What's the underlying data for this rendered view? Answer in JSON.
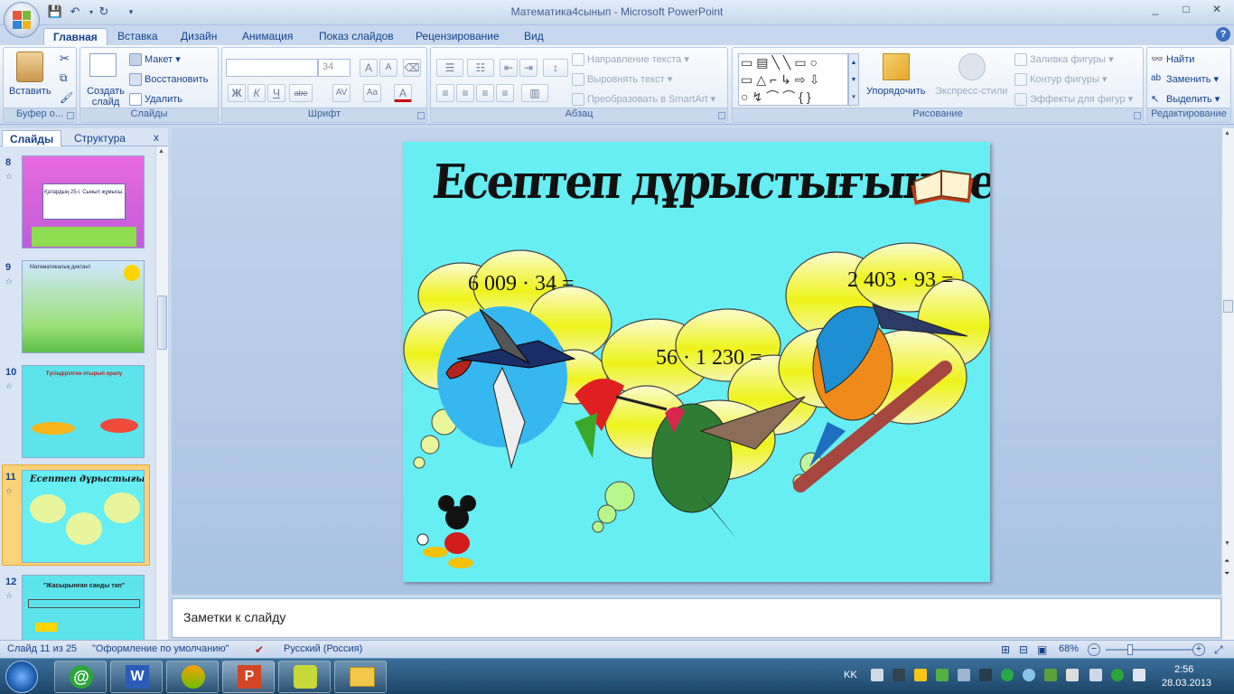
{
  "window": {
    "title": "Математика4сынып - Microsoft PowerPoint",
    "minimize": "_",
    "maximize": "□",
    "close": "✕"
  },
  "ribbon_tabs": [
    "Главная",
    "Вставка",
    "Дизайн",
    "Анимация",
    "Показ слайдов",
    "Рецензирование",
    "Вид"
  ],
  "help": "?",
  "groups": {
    "clipboard": {
      "label": "Буфер о...",
      "paste": "Вставить"
    },
    "slides": {
      "label": "Слайды",
      "new_slide": "Создать слайд",
      "layout": "Макет",
      "reset": "Восстановить",
      "delete": "Удалить"
    },
    "font": {
      "label": "Шрифт",
      "font_name": "",
      "font_size": "34",
      "bold": "Ж",
      "italic": "К",
      "underline": "Ч",
      "strike": "abe",
      "spacing": "AV",
      "case": "Aa",
      "color": "A",
      "grow": "A",
      "shrink": "A"
    },
    "paragraph": {
      "label": "Абзац",
      "text_direction": "Направление текста",
      "align_text": "Выровнять текст",
      "smartart": "Преобразовать в SmartArt"
    },
    "drawing": {
      "label": "Рисование",
      "arrange": "Упорядочить",
      "quick_styles": "Экспресс-стили",
      "shape_fill": "Заливка фигуры",
      "shape_outline": "Контур фигуры",
      "shape_effects": "Эффекты для фигур"
    },
    "editing": {
      "label": "Редактирование",
      "find": "Найти",
      "replace": "Заменить",
      "select": "Выделить"
    }
  },
  "left_pane": {
    "tab_slides": "Слайды",
    "tab_outline": "Структура",
    "close": "x",
    "thumbnails": [
      {
        "num": "8",
        "text": "Қатардың 25-і. Сынып жұмысы."
      },
      {
        "num": "9",
        "text": "Математикалық диктант"
      },
      {
        "num": "10",
        "text": "Түсіндірілген отырып оралу"
      },
      {
        "num": "11",
        "text": "Есептеп дұрыстығын тексер"
      },
      {
        "num": "12",
        "text": "\"Жасырынған санды тап\""
      }
    ]
  },
  "slide": {
    "title": "Есептеп дұрыстығын тексер",
    "expr1": "6 009 · 34 =",
    "expr2": "56 · 1 230 =",
    "expr3": "2 403 · 93 ="
  },
  "notes_placeholder": "Заметки к слайду",
  "status": {
    "slide_count": "Слайд 11 из 25",
    "theme": "\"Оформление по умолчанию\"",
    "language": "Русский (Россия)",
    "zoom": "68%"
  },
  "taskbar": {
    "lang": "KK",
    "time": "2:56",
    "date": "28.03.2013"
  },
  "colors": {
    "slide_bg": "#66eef3",
    "ribbon_text": "#15428b",
    "taskbar": "#1d4568"
  }
}
